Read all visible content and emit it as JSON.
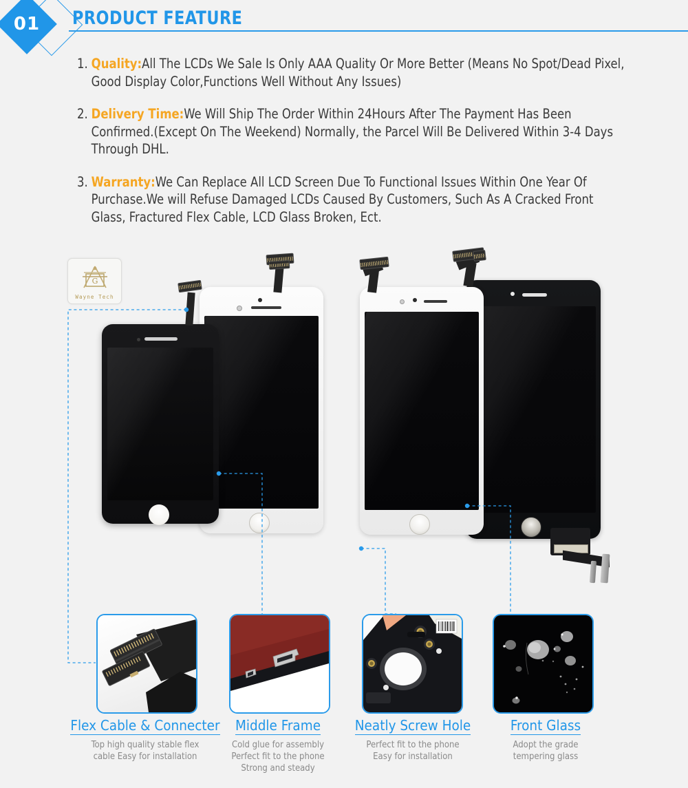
{
  "header": {
    "number": "01",
    "title": "PRODUCT FEATURE",
    "accent_color": "#2196E8"
  },
  "features": [
    {
      "num": "1.",
      "label": "Quality:",
      "text": "All The LCDs We Sale Is Only AAA Quality Or More Better (Means No Spot/Dead Pixel, Good Display Color,Functions Well Without Any Issues)"
    },
    {
      "num": "2.",
      "label": "Delivery Time:",
      "text": "We Will Ship The Order Within 24Hours After The Payment Has Been Confirmed.(Except On The Weekend) Normally, the Parcel Will Be Delivered Within 3-4 Days Through DHL."
    },
    {
      "num": "3.",
      "label": "Warranty:",
      "text": "We Can Replace All LCD Screen Due To Functional Issues Within One Year Of Purchase.We will Refuse Damaged LCDs Caused By Customers, Such As A Cracked Front Glass, Fractured Flex Cable, LCD Glass Broken, Ect."
    }
  ],
  "watermark": {
    "brand": "Wayne Tech",
    "emblem": "square-and-compass"
  },
  "details": [
    {
      "title": "Flex Cable & Connecter",
      "subtitle": "Top high quality stable flex\ncable Easy for installation",
      "image": "flex-cable-connector-photo"
    },
    {
      "title": "Middle Frame",
      "subtitle": "Cold glue for assembly\nPerfect fit to the phone\nStrong and steady",
      "image": "middle-frame-photo"
    },
    {
      "title": "Neatly Screw Hole",
      "subtitle": "Perfect fit to the phone\nEasy for installation",
      "image": "screw-hole-photo"
    },
    {
      "title": "Front Glass",
      "subtitle": "Adopt the grade\ntempering glass",
      "image": "front-glass-photo"
    }
  ],
  "colors": {
    "accent_blue": "#2196E8",
    "label_orange": "#F5A623",
    "body_gray": "#3a3a3a",
    "subtitle_gray": "#8a8a8a",
    "background": "#f2f2f2"
  }
}
